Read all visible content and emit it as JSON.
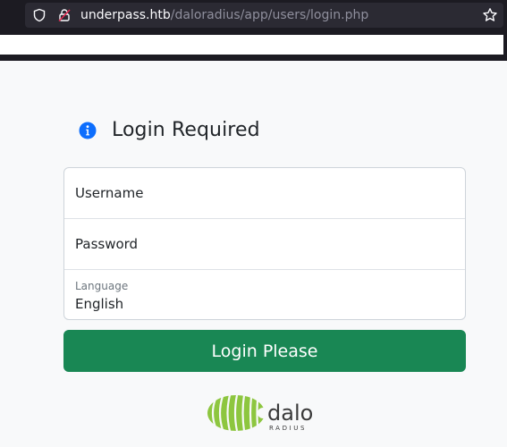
{
  "browser": {
    "url_host": "underpass.htb",
    "url_path": "/daloradius/app/users/login.php"
  },
  "login": {
    "heading": "Login Required",
    "username_placeholder": "Username",
    "password_placeholder": "Password",
    "language_label": "Language",
    "language_value": "English",
    "submit_label": "Login Please"
  },
  "logo": {
    "word": "dalo",
    "subword": "RADIUS"
  },
  "colors": {
    "accent_green": "#198754",
    "info_blue": "#0d6efd",
    "logo_green": "#8dc63f"
  }
}
